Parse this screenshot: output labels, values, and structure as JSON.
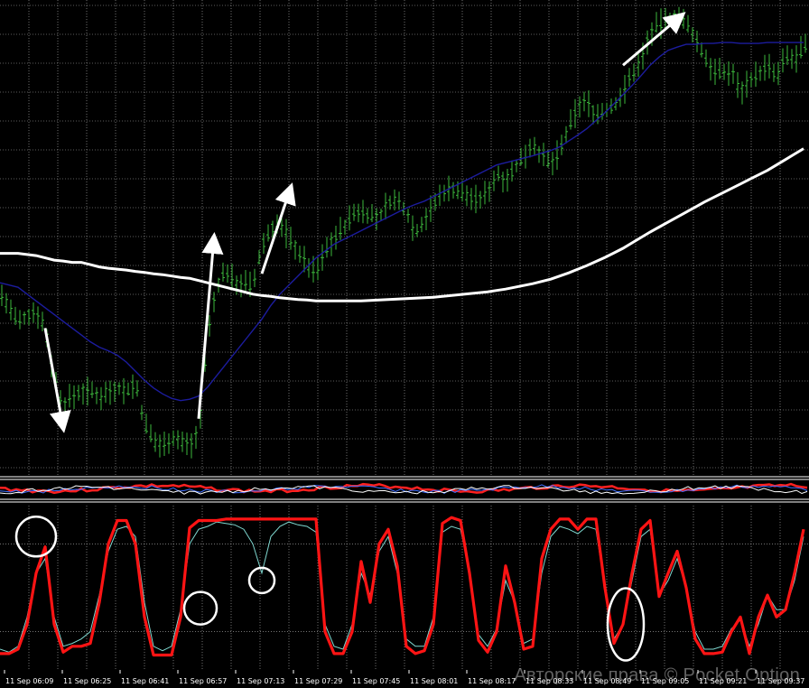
{
  "watermark": "Авторские права © Pocket Option",
  "chart_data": [
    {
      "type": "line",
      "panel": "price",
      "xlabel": "",
      "ylabel": "",
      "grid": true,
      "colors": {
        "background": "#000000",
        "grid": "#b9b9b9",
        "candles": "#3db83d",
        "slow_ma": "#ffffff",
        "fast_ma": "#1c1c9e",
        "annotation": "#ffffff"
      },
      "ylim": [
        0,
        100
      ],
      "x": [
        0,
        20,
        40,
        50,
        60,
        70,
        80,
        90,
        100,
        110,
        120,
        130,
        140,
        150,
        160,
        170,
        180,
        190,
        200,
        210,
        220,
        230,
        240,
        250,
        260,
        270,
        280,
        290,
        300,
        310,
        320,
        330,
        340,
        350,
        360,
        370,
        380,
        390,
        400,
        410,
        420,
        430,
        440,
        450,
        460,
        470,
        480,
        490,
        500,
        510,
        520,
        530,
        540,
        550,
        560,
        570,
        580,
        590,
        600,
        610,
        620,
        630,
        640,
        650,
        660,
        670,
        680,
        690,
        700,
        710,
        720,
        730,
        740,
        750,
        760,
        770,
        780,
        790,
        800,
        810,
        820,
        830,
        840,
        850,
        860,
        870,
        880,
        890
      ],
      "series": [
        {
          "role": "price",
          "values": [
            38,
            31,
            34,
            30,
            19,
            13,
            15,
            16,
            16,
            15,
            16,
            17,
            16,
            18,
            9,
            5,
            4,
            6,
            5,
            4,
            7,
            28,
            39,
            43,
            40,
            40,
            39,
            48,
            52,
            53,
            50,
            47,
            44,
            42,
            47,
            50,
            52,
            55,
            56,
            55,
            54,
            58,
            58,
            56,
            51,
            54,
            57,
            60,
            61,
            60,
            59,
            58,
            60,
            64,
            63,
            65,
            68,
            71,
            68,
            66,
            69,
            74,
            79,
            80,
            77,
            78,
            79,
            82,
            86,
            89,
            95,
            97,
            98,
            99,
            97,
            94,
            90,
            87,
            86,
            87,
            82,
            85,
            86,
            88,
            85,
            90,
            89,
            92
          ]
        },
        {
          "role": "slow-ma",
          "values": [
            46.5,
            46.5,
            46,
            45.5,
            45,
            44.8,
            44.5,
            44.5,
            44,
            43.5,
            43.2,
            43,
            42.8,
            42.5,
            42.3,
            42,
            41.8,
            41.5,
            41.2,
            41,
            40.5,
            40,
            39.5,
            39,
            38.5,
            38,
            37.5,
            37.2,
            37,
            36.7,
            36.5,
            36.3,
            36.2,
            36,
            36,
            36,
            36,
            36,
            36,
            36.1,
            36.2,
            36.3,
            36.4,
            36.5,
            36.6,
            36.7,
            36.8,
            37,
            37.2,
            37.4,
            37.6,
            37.8,
            38,
            38.3,
            38.6,
            39,
            39.4,
            39.8,
            40.3,
            40.8,
            41.5,
            42.2,
            43,
            43.8,
            44.7,
            45.6,
            46.6,
            47.6,
            48.8,
            50,
            51.2,
            52.3,
            53.4,
            54.5,
            55.6,
            56.7,
            57.8,
            58.8,
            59.8,
            60.8,
            61.8,
            62.8,
            63.8,
            64.8,
            66,
            67.2,
            68.4,
            69.6
          ]
        },
        {
          "role": "fast-ma",
          "values": [
            40,
            39,
            36,
            34.5,
            33,
            31.5,
            30,
            28.5,
            27,
            25.8,
            25,
            24,
            22.5,
            20.5,
            18.5,
            16.8,
            15.5,
            14.5,
            14,
            14.3,
            15,
            17,
            19.5,
            22,
            24.5,
            27,
            29.5,
            32,
            35,
            37.5,
            39.5,
            41.5,
            43.5,
            45.5,
            47,
            48.5,
            49.5,
            50.5,
            51.5,
            52.5,
            53.5,
            54.5,
            55.5,
            56.5,
            57.3,
            58,
            59,
            60,
            61,
            62,
            63,
            64,
            65,
            66,
            66.5,
            67,
            67.5,
            68,
            68.6,
            69.2,
            70,
            71.3,
            72.6,
            74,
            75.8,
            77.5,
            79.5,
            81.5,
            83.5,
            85.7,
            88,
            89.8,
            91.3,
            92,
            92.6,
            92.6,
            92.8,
            92.8,
            93,
            93,
            92.8,
            92.8,
            92.8,
            93,
            93,
            93,
            93,
            93
          ]
        }
      ],
      "annotations": [
        {
          "type": "arrow",
          "from": [
            50,
            30
          ],
          "to": [
            70,
            8
          ]
        },
        {
          "type": "arrow",
          "from": [
            220,
            10
          ],
          "to": [
            237,
            50
          ]
        },
        {
          "type": "arrow",
          "from": [
            290,
            42
          ],
          "to": [
            322,
            61
          ]
        },
        {
          "type": "arrow",
          "from": [
            690,
            88
          ],
          "to": [
            755,
            99
          ]
        }
      ]
    },
    {
      "type": "line",
      "panel": "middle-indicator",
      "xlabel": "",
      "ylabel": "",
      "grid": false,
      "colors": {
        "red": "#ff2020",
        "blue": "#3f6fff",
        "white": "#ffffff"
      }
    },
    {
      "type": "line",
      "panel": "stochastic",
      "xlabel": "",
      "ylabel": "",
      "grid": true,
      "ylim": [
        0,
        100
      ],
      "colors": {
        "main": "#ff1414",
        "signal": "#7fd8d0",
        "circle": "#ffffff"
      },
      "categories": [
        "11 Sep 06:09",
        "11 Sep 06:25",
        "11 Sep 06:41",
        "11 Sep 06:57",
        "11 Sep 07:13",
        "11 Sep 07:29",
        "11 Sep 07:45",
        "11 Sep 08:01",
        "11 Sep 08:17",
        "11 Sep 08:33",
        "11 Sep 08:49",
        "11 Sep 09:05",
        "11 Sep 09:21",
        "11 Sep 09:37"
      ],
      "x": [
        0,
        10,
        20,
        30,
        40,
        50,
        60,
        70,
        80,
        90,
        100,
        110,
        120,
        130,
        140,
        150,
        160,
        170,
        180,
        190,
        200,
        210,
        220,
        230,
        240,
        250,
        260,
        270,
        280,
        290,
        300,
        310,
        320,
        330,
        340,
        350,
        360,
        370,
        380,
        390,
        400,
        410,
        420,
        430,
        440,
        450,
        460,
        470,
        480,
        490,
        500,
        510,
        520,
        530,
        540,
        550,
        560,
        570,
        580,
        590,
        600,
        610,
        620,
        630,
        640,
        650,
        660,
        670,
        680,
        690,
        700,
        710,
        720,
        730,
        740,
        750,
        760,
        770,
        780,
        790,
        800,
        810,
        820,
        830,
        840,
        850,
        860,
        870,
        880,
        890
      ],
      "series": [
        {
          "role": "main",
          "values": [
            5,
            5,
            8,
            25,
            60,
            78,
            25,
            6,
            10,
            10,
            12,
            40,
            80,
            96,
            96,
            80,
            30,
            4,
            4,
            4,
            30,
            91,
            96,
            96,
            96,
            97,
            97,
            97,
            97,
            97,
            97,
            97,
            97,
            97,
            97,
            97,
            20,
            5,
            5,
            20,
            68,
            40,
            80,
            90,
            65,
            10,
            5,
            7,
            25,
            94,
            98,
            96,
            60,
            14,
            6,
            20,
            65,
            40,
            8,
            10,
            70,
            90,
            97,
            97,
            90,
            97,
            97,
            50,
            12,
            25,
            60,
            90,
            96,
            44,
            60,
            75,
            50,
            15,
            5,
            5,
            6,
            20,
            30,
            5,
            30,
            45,
            30,
            35,
            60,
            90
          ]
        },
        {
          "role": "signal",
          "values": [
            8,
            6,
            10,
            30,
            60,
            70,
            30,
            10,
            12,
            15,
            20,
            45,
            75,
            90,
            92,
            85,
            40,
            10,
            7,
            10,
            35,
            80,
            90,
            92,
            95,
            94,
            93,
            90,
            80,
            60,
            85,
            92,
            95,
            93,
            92,
            88,
            25,
            10,
            8,
            25,
            60,
            45,
            75,
            85,
            60,
            15,
            10,
            10,
            30,
            88,
            92,
            90,
            62,
            18,
            10,
            22,
            55,
            40,
            12,
            15,
            60,
            85,
            92,
            90,
            87,
            92,
            90,
            50,
            15,
            25,
            55,
            85,
            90,
            45,
            55,
            70,
            50,
            20,
            8,
            8,
            10,
            22,
            28,
            10,
            25,
            45,
            35,
            35,
            55,
            85
          ]
        }
      ],
      "annotations": [
        {
          "type": "circle",
          "x": 40,
          "y": 85
        },
        {
          "type": "circle",
          "x": 222,
          "y": 36
        },
        {
          "type": "circle",
          "x": 290,
          "y": 55
        },
        {
          "type": "ellipse",
          "x": 693,
          "y": 25
        }
      ]
    }
  ]
}
